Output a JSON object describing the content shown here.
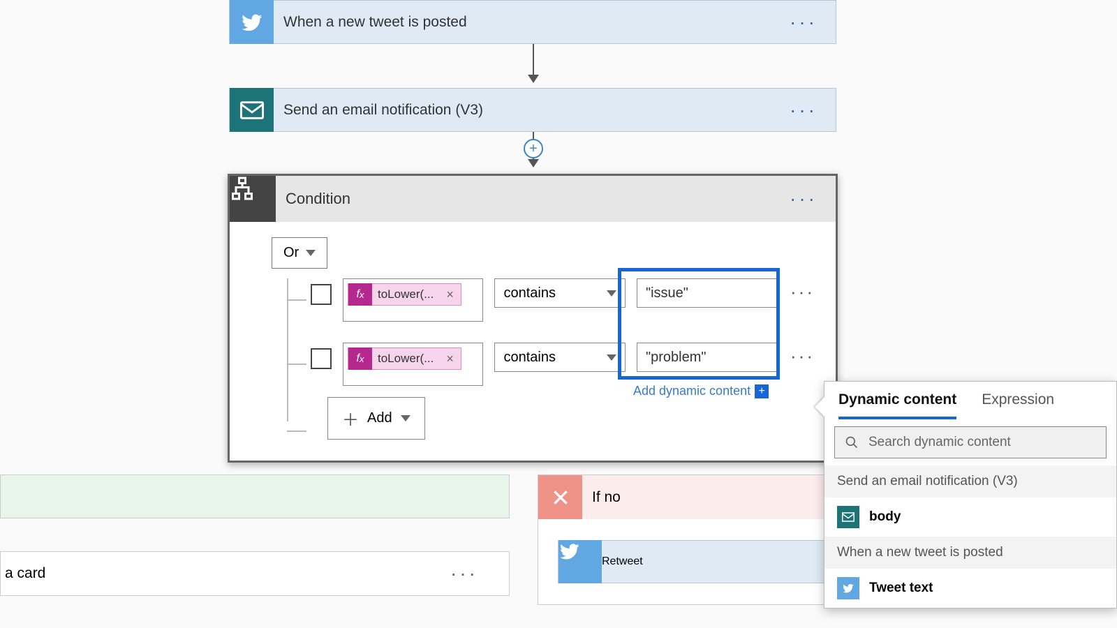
{
  "cards": {
    "trigger": {
      "title": "When a new tweet is posted"
    },
    "email": {
      "title": "Send an email notification (V3)"
    },
    "condition": {
      "title": "Condition"
    },
    "retweet": {
      "title": "Retweet"
    }
  },
  "condition": {
    "combinator": "Or",
    "add_label": "Add",
    "add_dynamic": "Add dynamic content",
    "rows": [
      {
        "token": "toLower(...",
        "op": "contains",
        "value": "\"issue\""
      },
      {
        "token": "toLower(...",
        "op": "contains",
        "value": "\"problem\""
      }
    ]
  },
  "branches": {
    "if_no": "If no",
    "left_card_text": "a card"
  },
  "dc_panel": {
    "tab_dynamic": "Dynamic content",
    "tab_expression": "Expression",
    "search_placeholder": "Search dynamic content",
    "groups": [
      {
        "title": "Send an email notification (V3)",
        "items": [
          {
            "label": "body",
            "icon": "mail"
          }
        ]
      },
      {
        "title": "When a new tweet is posted",
        "items": [
          {
            "label": "Tweet text",
            "icon": "twitter"
          }
        ]
      }
    ]
  }
}
